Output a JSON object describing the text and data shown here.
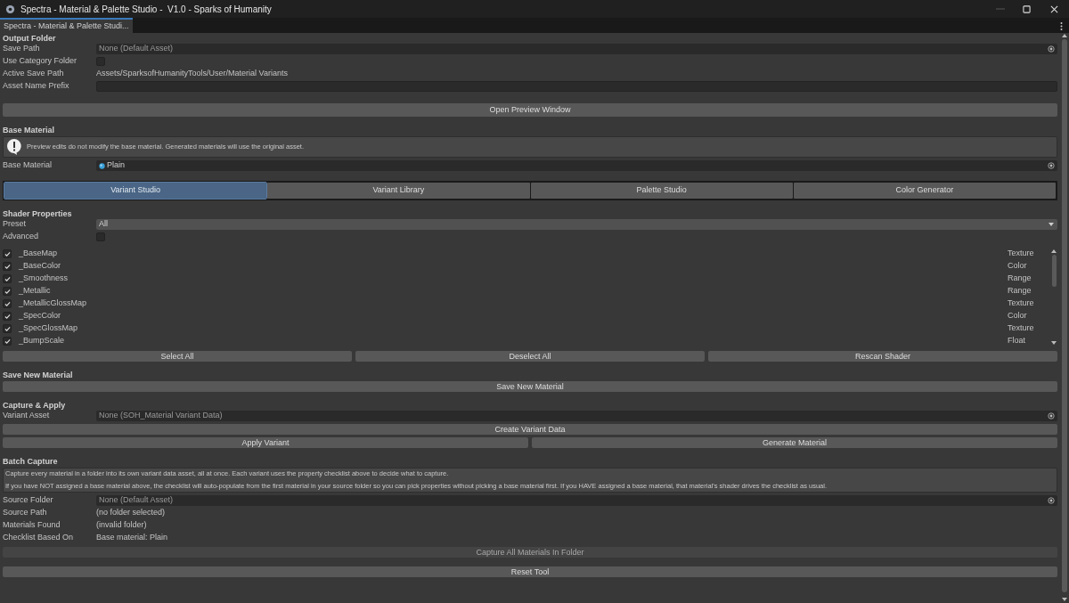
{
  "window": {
    "title": "Spectra - Material & Palette Studio -  V1.0 - Sparks of Humanity"
  },
  "tab": {
    "label": "Spectra - Material & Palette Studi..."
  },
  "content": [
    {
      "kind": "heading",
      "text": "Output Folder"
    },
    {
      "kind": "object",
      "label": "Save Path",
      "value": "None (Default Asset)"
    },
    {
      "kind": "checkbox",
      "label": "Use Category Folder",
      "checked": false
    },
    {
      "kind": "info",
      "label": "Active Save Path",
      "value": "Assets/SparksofHumanityTools/User/Material Variants"
    },
    {
      "kind": "text_input",
      "label": "Asset Name Prefix"
    },
    {
      "kind": "button",
      "label": "Open Preview Window",
      "disabled": false
    },
    {
      "kind": "heading",
      "text": "Base Material"
    },
    {
      "kind": "help",
      "icon": true,
      "paragraphs": [
        "Preview edits do not modify the base material. Generated materials will use the original asset."
      ]
    },
    {
      "kind": "material",
      "label": "Base Material",
      "value": "Plain"
    },
    {
      "kind": "tabs",
      "tabs": [
        {
          "label": "Variant Studio",
          "selected": true
        },
        {
          "label": "Variant Library",
          "selected": false
        },
        {
          "label": "Palette Studio",
          "selected": false
        },
        {
          "label": "Color Generator",
          "selected": false
        }
      ]
    },
    {
      "kind": "heading",
      "text": "Shader Properties"
    },
    {
      "kind": "dropdown",
      "label": "Preset",
      "value": "All"
    },
    {
      "kind": "checkbox",
      "label": "Advanced",
      "checked": false
    },
    {
      "kind": "property_list",
      "items": [
        {
          "name": "_BaseMap",
          "type": "Texture",
          "checked": true
        },
        {
          "name": "_BaseColor",
          "type": "Color",
          "checked": true
        },
        {
          "name": "_Smoothness",
          "type": "Range",
          "checked": true
        },
        {
          "name": "_Metallic",
          "type": "Range",
          "checked": true
        },
        {
          "name": "_MetallicGlossMap",
          "type": "Texture",
          "checked": true
        },
        {
          "name": "_SpecColor",
          "type": "Color",
          "checked": true
        },
        {
          "name": "_SpecGlossMap",
          "type": "Texture",
          "checked": true
        },
        {
          "name": "_BumpScale",
          "type": "Float",
          "checked": true
        }
      ]
    },
    {
      "kind": "button_row",
      "buttons": [
        {
          "label": "Select All",
          "disabled": false
        },
        {
          "label": "Deselect All",
          "disabled": false
        },
        {
          "label": "Rescan Shader",
          "disabled": false
        }
      ]
    },
    {
      "kind": "heading",
      "text": "Save New Material"
    },
    {
      "kind": "button",
      "label": "Save New Material",
      "disabled": false
    },
    {
      "kind": "heading",
      "text": "Capture & Apply"
    },
    {
      "kind": "object",
      "label": "Variant Asset",
      "value": "None (SOH_Material Variant Data)"
    },
    {
      "kind": "button",
      "label": "Create Variant Data",
      "disabled": false
    },
    {
      "kind": "button_row",
      "buttons": [
        {
          "label": "Apply Variant",
          "disabled": false
        },
        {
          "label": "Generate Material",
          "disabled": false
        }
      ]
    },
    {
      "kind": "heading",
      "text": "Batch Capture"
    },
    {
      "kind": "help",
      "icon": false,
      "paragraphs": [
        "Capture every material in a folder into its own variant data asset, all at once. Each variant uses the property checklist above to decide what to capture.",
        "If you have NOT assigned a base material above, the checklist will auto-populate from the first material in your source folder so you can pick properties without picking a base material first. If you HAVE assigned a base material, that material's shader drives the checklist as usual."
      ]
    },
    {
      "kind": "object",
      "label": "Source Folder",
      "value": "None (Default Asset)"
    },
    {
      "kind": "info",
      "label": "Source Path",
      "value": "(no folder selected)"
    },
    {
      "kind": "info",
      "label": "Materials Found",
      "value": "(invalid folder)"
    },
    {
      "kind": "info",
      "label": "Checklist Based On",
      "value": "Base material: Plain"
    },
    {
      "kind": "button",
      "label": "Capture All Materials In Folder",
      "disabled": true
    },
    {
      "kind": "button",
      "label": "Reset Tool",
      "disabled": false
    }
  ]
}
